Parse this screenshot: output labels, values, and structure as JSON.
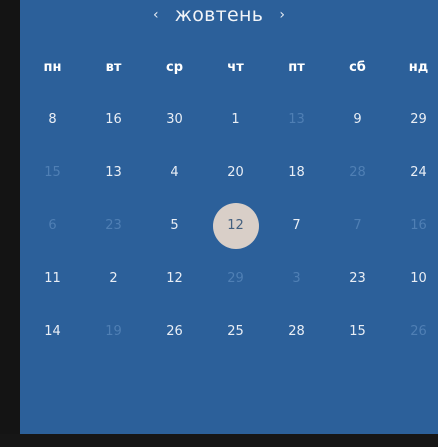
{
  "header": {
    "month": "жовтень",
    "prev_icon": "chevron-left-icon",
    "next_icon": "chevron-right-icon",
    "prev_glyph": "‹",
    "next_glyph": "›"
  },
  "weekdays": [
    "пн",
    "вт",
    "ср",
    "чт",
    "пт",
    "сб",
    "нд"
  ],
  "weeks": [
    [
      {
        "d": "8",
        "cur": true
      },
      {
        "d": "16",
        "cur": true
      },
      {
        "d": "30",
        "cur": true
      },
      {
        "d": "1",
        "cur": true
      },
      {
        "d": "13",
        "cur": false
      },
      {
        "d": "9",
        "cur": true
      },
      {
        "d": "29",
        "cur": true
      }
    ],
    [
      {
        "d": "15",
        "cur": false
      },
      {
        "d": "13",
        "cur": true
      },
      {
        "d": "4",
        "cur": true
      },
      {
        "d": "20",
        "cur": true
      },
      {
        "d": "18",
        "cur": true
      },
      {
        "d": "28",
        "cur": false
      },
      {
        "d": "24",
        "cur": true
      }
    ],
    [
      {
        "d": "6",
        "cur": false
      },
      {
        "d": "23",
        "cur": false
      },
      {
        "d": "5",
        "cur": true
      },
      {
        "d": "12",
        "cur": true,
        "selected": true
      },
      {
        "d": "7",
        "cur": true
      },
      {
        "d": "7",
        "cur": false
      },
      {
        "d": "16",
        "cur": false
      }
    ],
    [
      {
        "d": "11",
        "cur": true
      },
      {
        "d": "2",
        "cur": true
      },
      {
        "d": "12",
        "cur": true
      },
      {
        "d": "29",
        "cur": false
      },
      {
        "d": "3",
        "cur": false
      },
      {
        "d": "23",
        "cur": true
      },
      {
        "d": "10",
        "cur": true
      }
    ],
    [
      {
        "d": "14",
        "cur": true
      },
      {
        "d": "19",
        "cur": false
      },
      {
        "d": "26",
        "cur": true
      },
      {
        "d": "25",
        "cur": true
      },
      {
        "d": "28",
        "cur": true
      },
      {
        "d": "15",
        "cur": true
      },
      {
        "d": "26",
        "cur": false
      }
    ]
  ],
  "colors": {
    "panel": "#2c609a",
    "selected_circle": "#d9cfc8",
    "other_month_text": "#4f7fb4"
  }
}
